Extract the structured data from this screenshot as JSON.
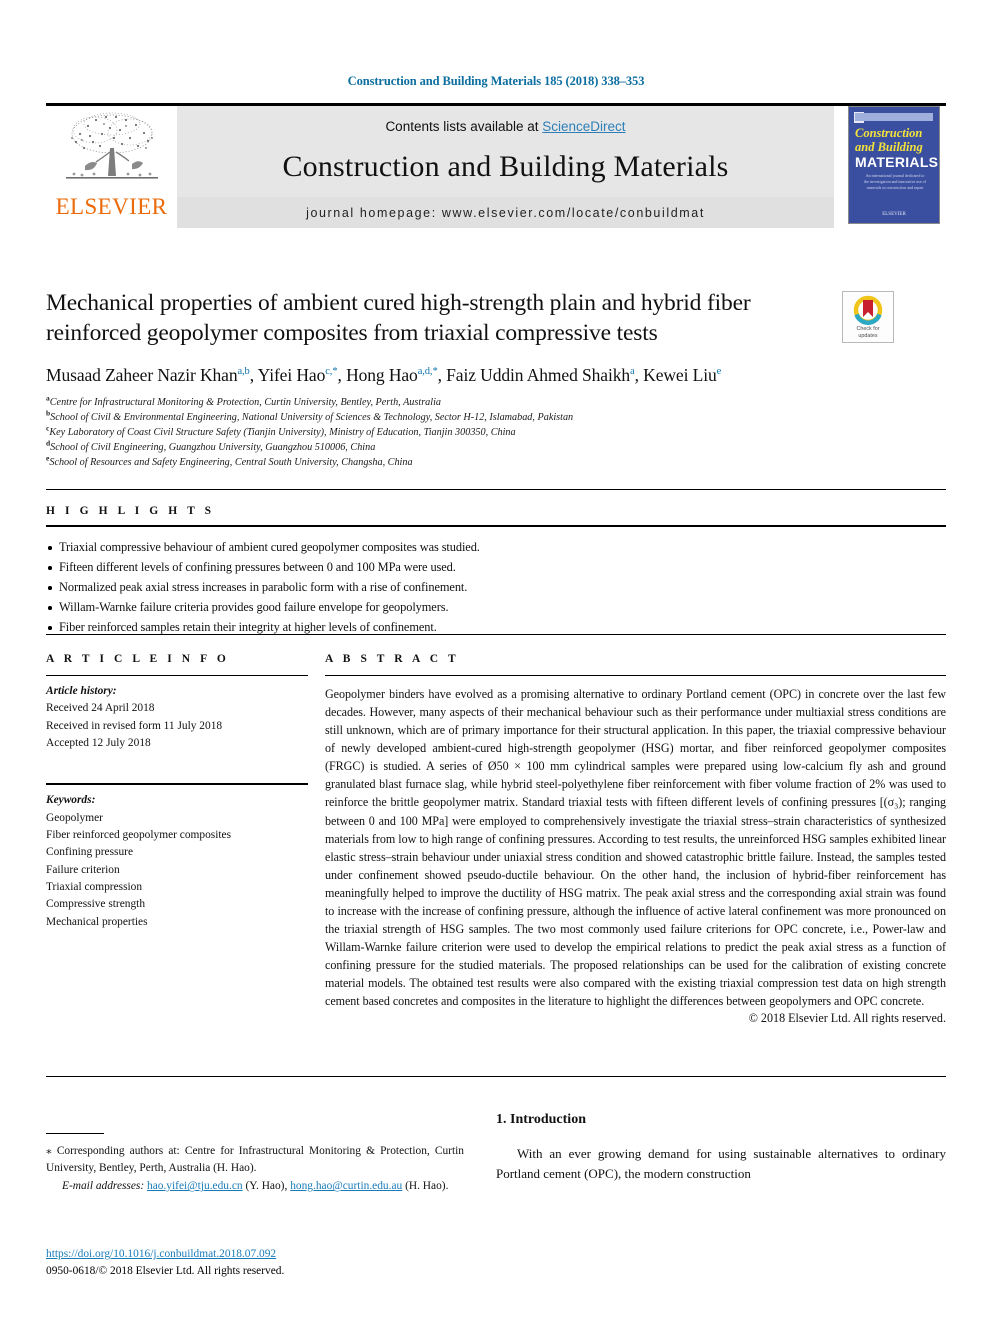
{
  "running_head": "Construction and Building Materials 185 (2018) 338–353",
  "masthead": {
    "elsevier_wordmark": "ELSEVIER",
    "contents_prefix": "Contents lists available at ",
    "sciencedirect_link": "ScienceDirect",
    "journal_title": "Construction and Building Materials",
    "homepage_line": "journal homepage: www.elsevier.com/locate/conbuildmat",
    "cover": {
      "line1": "Construction",
      "line2": "and Building",
      "line3": "MATERIALS",
      "blurb": "An international journal dedicated to the investigation and innovative use of materials in construction and repair",
      "publisher": "ELSEVIER"
    },
    "accent_color": "#eb6a09",
    "link_color": "#2d7fb8"
  },
  "article": {
    "title": "Mechanical properties of ambient cured high-strength plain and hybrid fiber reinforced geopolymer composites from triaxial compressive tests",
    "crossmark": {
      "line1": "Check for",
      "line2": "updates"
    },
    "authors": [
      {
        "name": "Musaad Zaheer Nazir Khan",
        "sup": "a,b"
      },
      {
        "name": "Yifei Hao",
        "sup": "c,*"
      },
      {
        "name": "Hong Hao",
        "sup": "a,d,*"
      },
      {
        "name": "Faiz Uddin Ahmed Shaikh",
        "sup": "a"
      },
      {
        "name": "Kewei Liu",
        "sup": "e"
      }
    ],
    "affiliations": [
      {
        "mark": "a",
        "text": "Centre for Infrastructural Monitoring & Protection, Curtin University, Bentley, Perth, Australia"
      },
      {
        "mark": "b",
        "text": "School of Civil & Environmental Engineering, National University of Sciences & Technology, Sector H-12, Islamabad, Pakistan"
      },
      {
        "mark": "c",
        "text": "Key Laboratory of Coast Civil Structure Safety (Tianjin University), Ministry of Education, Tianjin 300350, China"
      },
      {
        "mark": "d",
        "text": "School of Civil Engineering, Guangzhou University, Guangzhou 510006, China"
      },
      {
        "mark": "e",
        "text": "School of Resources and Safety Engineering, Central South University, Changsha, China"
      }
    ]
  },
  "highlights": {
    "heading": "H I G H L I G H T S",
    "items": [
      "Triaxial compressive behaviour of ambient cured geopolymer composites was studied.",
      "Fifteen different levels of confining pressures between 0 and 100 MPa were used.",
      "Normalized peak axial stress increases in parabolic form with a rise of confinement.",
      "Willam-Warnke failure criteria provides good failure envelope for geopolymers.",
      "Fiber reinforced samples retain their integrity at higher levels of confinement."
    ]
  },
  "article_info": {
    "heading": "A R T I C L E   I N F O",
    "history_label": "Article history:",
    "history": [
      "Received 24 April 2018",
      "Received in revised form 11 July 2018",
      "Accepted 12 July 2018"
    ],
    "keywords_label": "Keywords:",
    "keywords": [
      "Geopolymer",
      "Fiber reinforced geopolymer composites",
      "Confining pressure",
      "Failure criterion",
      "Triaxial compression",
      "Compressive strength",
      "Mechanical properties"
    ]
  },
  "abstract": {
    "heading": "A B S T R A C T",
    "body": "Geopolymer binders have evolved as a promising alternative to ordinary Portland cement (OPC) in concrete over the last few decades. However, many aspects of their mechanical behaviour such as their performance under multiaxial stress conditions are still unknown, which are of primary importance for their structural application. In this paper, the triaxial compressive behaviour of newly developed ambient-cured high-strength geopolymer (HSG) mortar, and fiber reinforced geopolymer composites (FRGC) is studied. A series of Ø50 × 100 mm cylindrical samples were prepared using low-calcium fly ash and ground granulated blast furnace slag, while hybrid steel-polyethylene fiber reinforcement with fiber volume fraction of 2% was used to reinforce the brittle geopolymer matrix. Standard triaxial tests with fifteen different levels of confining pressures [(σ₃); ranging between 0 and 100 MPa] were employed to comprehensively investigate the triaxial stress–strain characteristics of synthesized materials from low to high range of confining pressures. According to test results, the unreinforced HSG samples exhibited linear elastic stress–strain behaviour under uniaxial stress condition and showed catastrophic brittle failure. Instead, the samples tested under confinement showed pseudo-ductile behaviour. On the other hand, the inclusion of hybrid-fiber reinforcement has meaningfully helped to improve the ductility of HSG matrix. The peak axial stress and the corresponding axial strain was found to increase with the increase of confining pressure, although the influence of active lateral confinement was more pronounced on the triaxial strength of HSG samples. The two most commonly used failure criterions for OPC concrete, i.e., Power-law and Willam-Warnke failure criterion were used to develop the empirical relations to predict the peak axial stress as a function of confining pressure for the studied materials. The proposed relationships can be used for the calibration of existing concrete material models. The obtained test results were also compared with the existing triaxial compression test data on high strength cement based concretes and composites in the literature to highlight the differences between geopolymers and OPC concrete.",
    "copyright": "© 2018 Elsevier Ltd. All rights reserved."
  },
  "footnote": {
    "corresponding": "⁎ Corresponding authors at: Centre for Infrastructural Monitoring & Protection, Curtin University, Bentley, Perth, Australia (H. Hao).",
    "email_label": "E-mail addresses:",
    "email_1": "hao.yifei@tju.edu.cn",
    "email_1_who": "(Y. Hao),",
    "email_2": "hong.hao@curtin.edu.au",
    "email_2_who": "(H. Hao).",
    "doi": "https://doi.org/10.1016/j.conbuildmat.2018.07.092",
    "issn_line": "0950-0618/© 2018 Elsevier Ltd. All rights reserved."
  },
  "introduction": {
    "heading": "1. Introduction",
    "paragraph": "With an ever growing demand for using sustainable alternatives to ordinary Portland cement (OPC), the modern construction"
  }
}
